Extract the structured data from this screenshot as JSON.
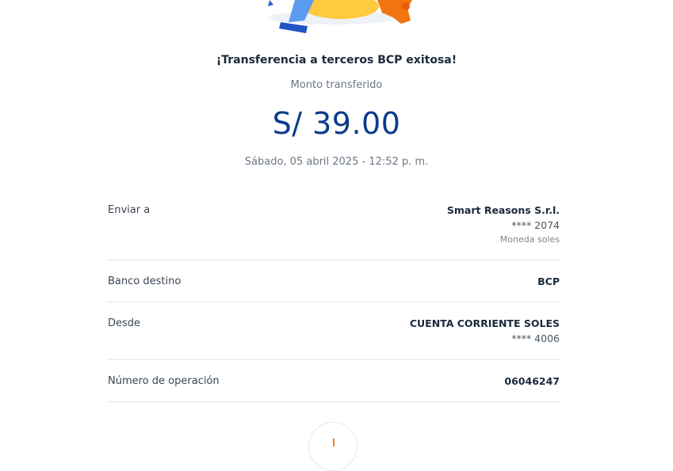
{
  "receipt": {
    "title": "¡Transferencia a terceros BCP exitosa!",
    "amount_label": "Monto transferido",
    "amount": "S/ 39.00",
    "datetime": "Sábado, 05 abril 2025 - 12:52 p. m."
  },
  "details": {
    "recipient": {
      "label": "Enviar a",
      "name": "Smart Reasons S.r.l.",
      "account": "**** 2074",
      "currency": "Moneda soles"
    },
    "bank": {
      "label": "Banco destino",
      "value": "BCP"
    },
    "source": {
      "label": "Desde",
      "account_type": "CUENTA CORRIENTE SOLES",
      "account": "**** 4006"
    },
    "operation": {
      "label": "Número de operación",
      "value": "06046247"
    }
  },
  "colors": {
    "amount": "#0b3b8c",
    "accent": "#f07a1a",
    "divider": "#e2e6ea"
  },
  "icons": {
    "download": "download-icon"
  }
}
